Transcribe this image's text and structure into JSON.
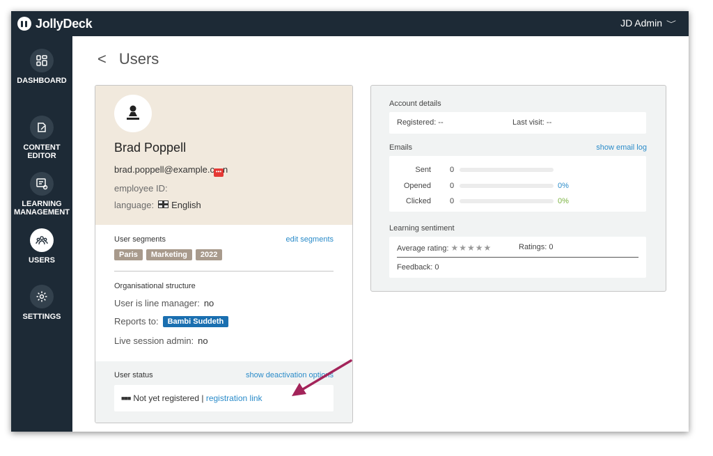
{
  "app": {
    "name": "JollyDeck"
  },
  "account": {
    "label": "JD Admin"
  },
  "nav": {
    "items": [
      {
        "label": "DASHBOARD"
      },
      {
        "label": "CONTENT EDITOR"
      },
      {
        "label": "LEARNING MANAGEMENT"
      },
      {
        "label": "USERS"
      },
      {
        "label": "SETTINGS"
      }
    ]
  },
  "page": {
    "title": "Users"
  },
  "profile": {
    "name": "Brad Poppell",
    "email_prefix": "brad.poppell@example.c",
    "email_suffix": "n",
    "employee_id_label": "employee ID:",
    "language_label": "language:",
    "language_value": "English"
  },
  "segments": {
    "title": "User segments",
    "edit_link": "edit segments",
    "tags": [
      "Paris",
      "Marketing",
      "2022"
    ]
  },
  "org": {
    "title": "Organisational structure",
    "line_manager_label": "User is line manager:",
    "line_manager_value": "no",
    "reports_to_label": "Reports to:",
    "reports_to_value": "Bambi Suddeth",
    "live_admin_label": "Live session admin:",
    "live_admin_value": "no"
  },
  "status": {
    "title": "User status",
    "deactivation_link": "show deactivation options",
    "dots": "■■■",
    "text": "Not yet registered |",
    "registration_link": "registration link"
  },
  "account_details": {
    "title": "Account details",
    "registered": "Registered: --",
    "last_visit": "Last visit: --"
  },
  "emails": {
    "title": "Emails",
    "log_link": "show email log",
    "rows": [
      {
        "label": "Sent",
        "count": "0",
        "pct": ""
      },
      {
        "label": "Opened",
        "count": "0",
        "pct": "0%"
      },
      {
        "label": "Clicked",
        "count": "0",
        "pct": "0%"
      }
    ],
    "colors": {
      "opened": "#2a8bc9",
      "clicked": "#7cb342"
    }
  },
  "sentiment": {
    "title": "Learning sentiment",
    "avg_rating_label": "Average rating:",
    "stars": "★★★★★",
    "ratings": "Ratings: 0",
    "feedback": "Feedback: 0"
  },
  "colors": {
    "sidebar": "#1d2a36",
    "accent": "#2a8bc9",
    "annotation_arrow": "#a3245a"
  }
}
